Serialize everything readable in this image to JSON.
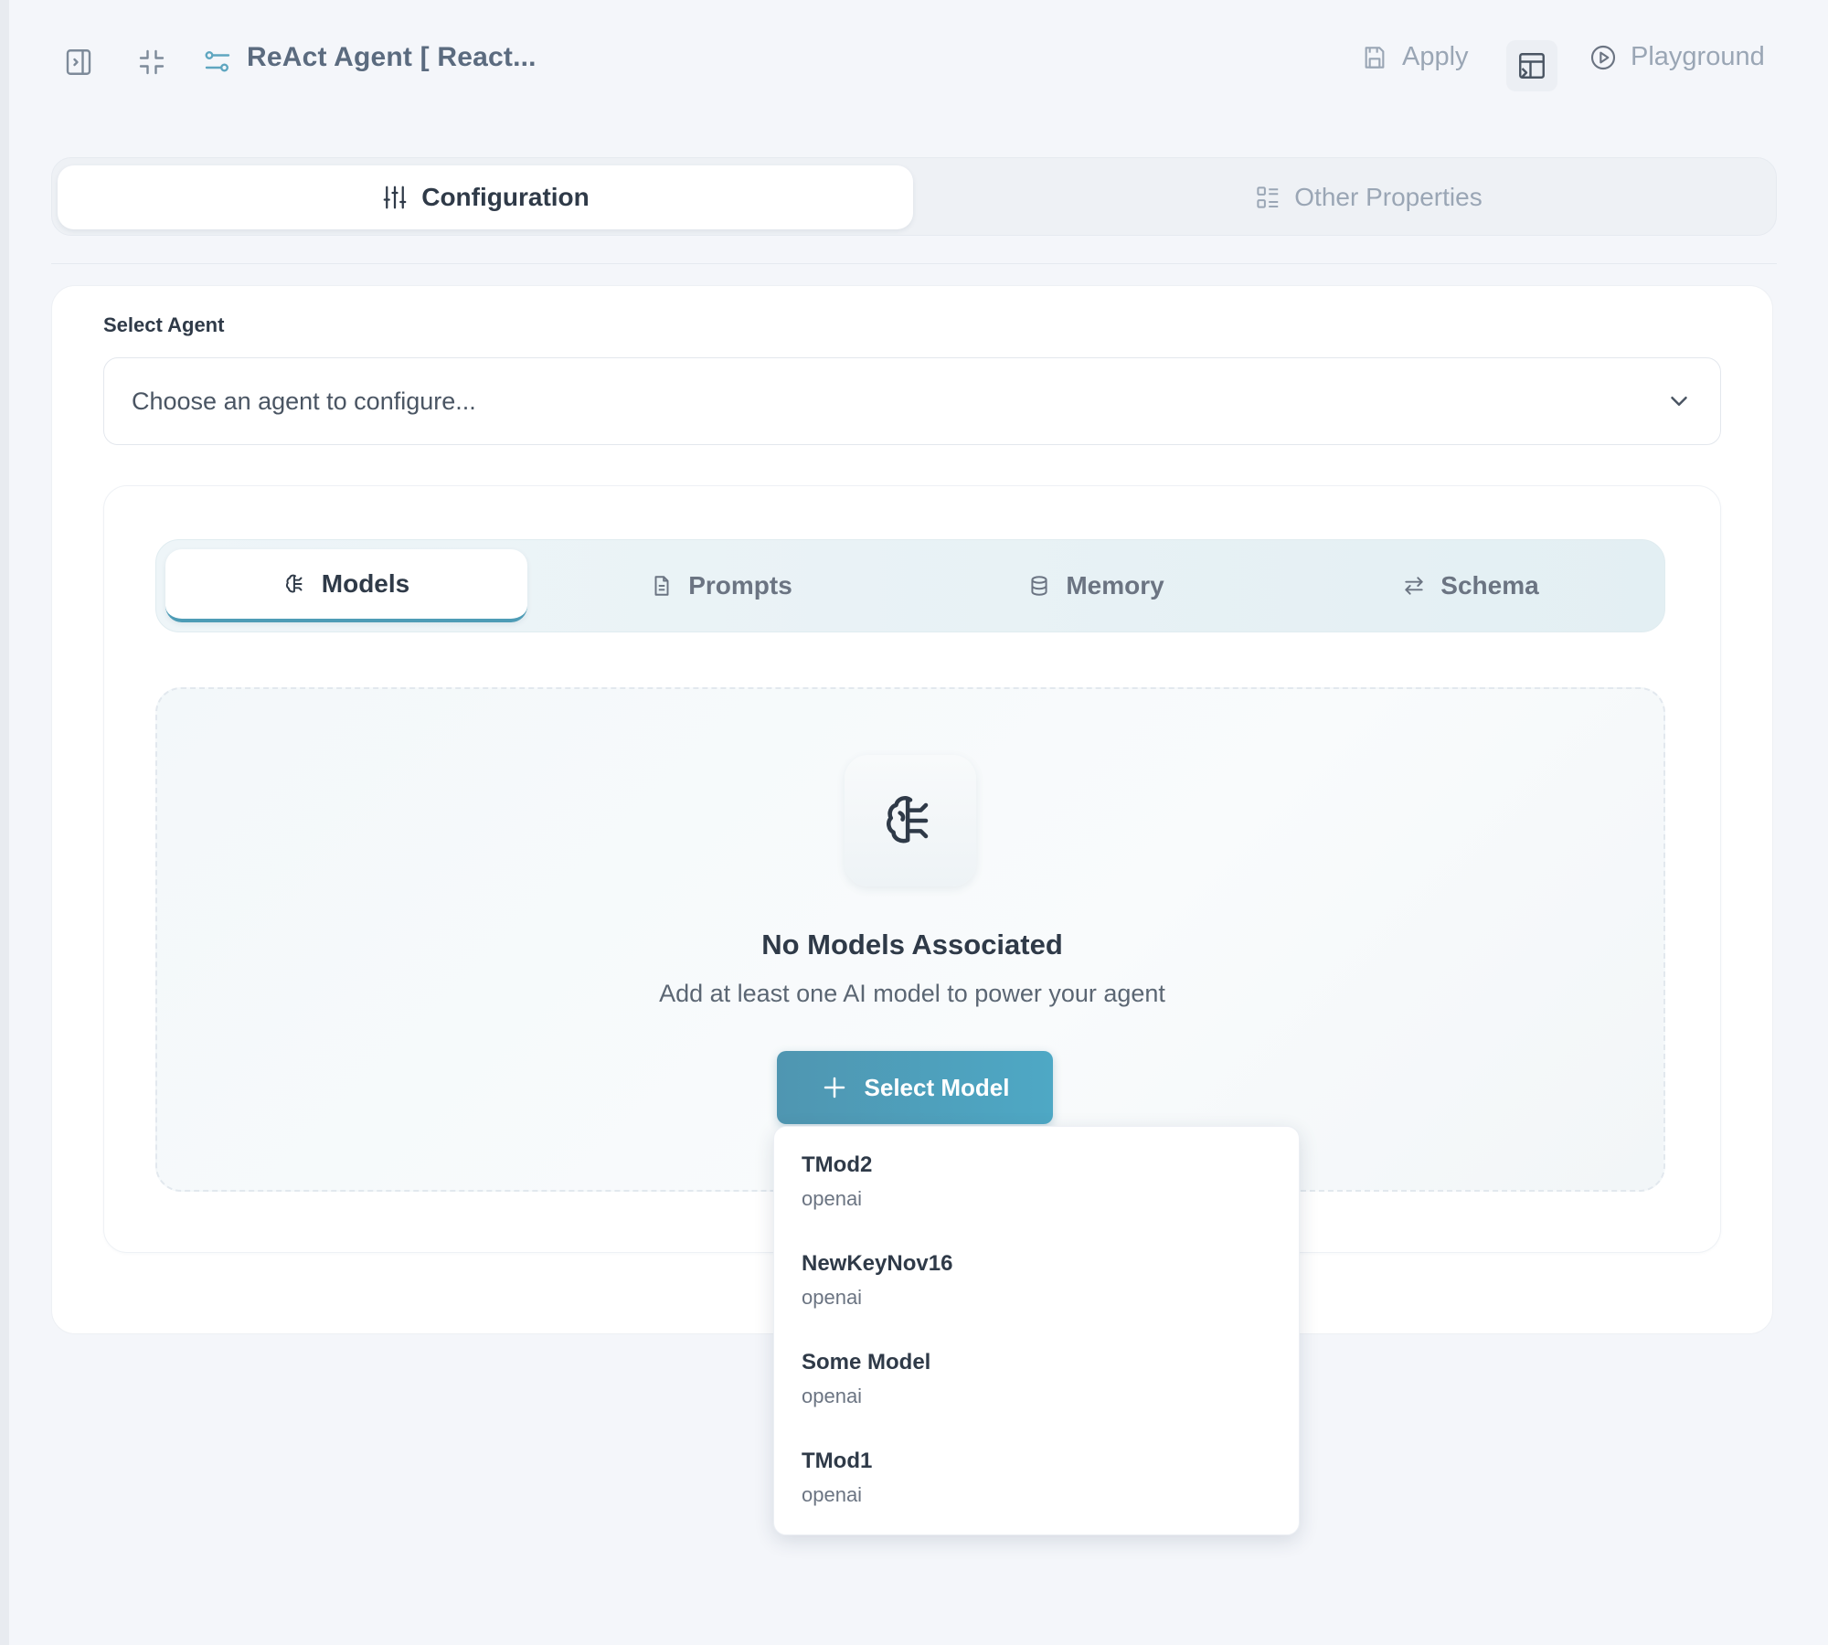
{
  "header": {
    "title": "ReAct Agent [ React...",
    "apply_label": "Apply",
    "playground_label": "Playground"
  },
  "top_tabs": [
    {
      "label": "Configuration",
      "active": true
    },
    {
      "label": "Other Properties",
      "active": false
    }
  ],
  "agent_select": {
    "label": "Select Agent",
    "placeholder": "Choose an agent to configure..."
  },
  "sub_tabs": [
    {
      "label": "Models",
      "active": true
    },
    {
      "label": "Prompts",
      "active": false
    },
    {
      "label": "Memory",
      "active": false
    },
    {
      "label": "Schema",
      "active": false
    }
  ],
  "empty_state": {
    "title": "No Models Associated",
    "subtitle": "Add at least one AI model to power your agent",
    "button_label": "Select Model"
  },
  "model_options": [
    {
      "name": "TMod2",
      "provider": "openai"
    },
    {
      "name": "NewKeyNov16",
      "provider": "openai"
    },
    {
      "name": "Some Model",
      "provider": "openai"
    },
    {
      "name": "TMod1",
      "provider": "openai"
    }
  ],
  "colors": {
    "accent": "#4ea8c5",
    "title_text": "#5b6b7f",
    "muted_text": "#9aa6b5"
  }
}
